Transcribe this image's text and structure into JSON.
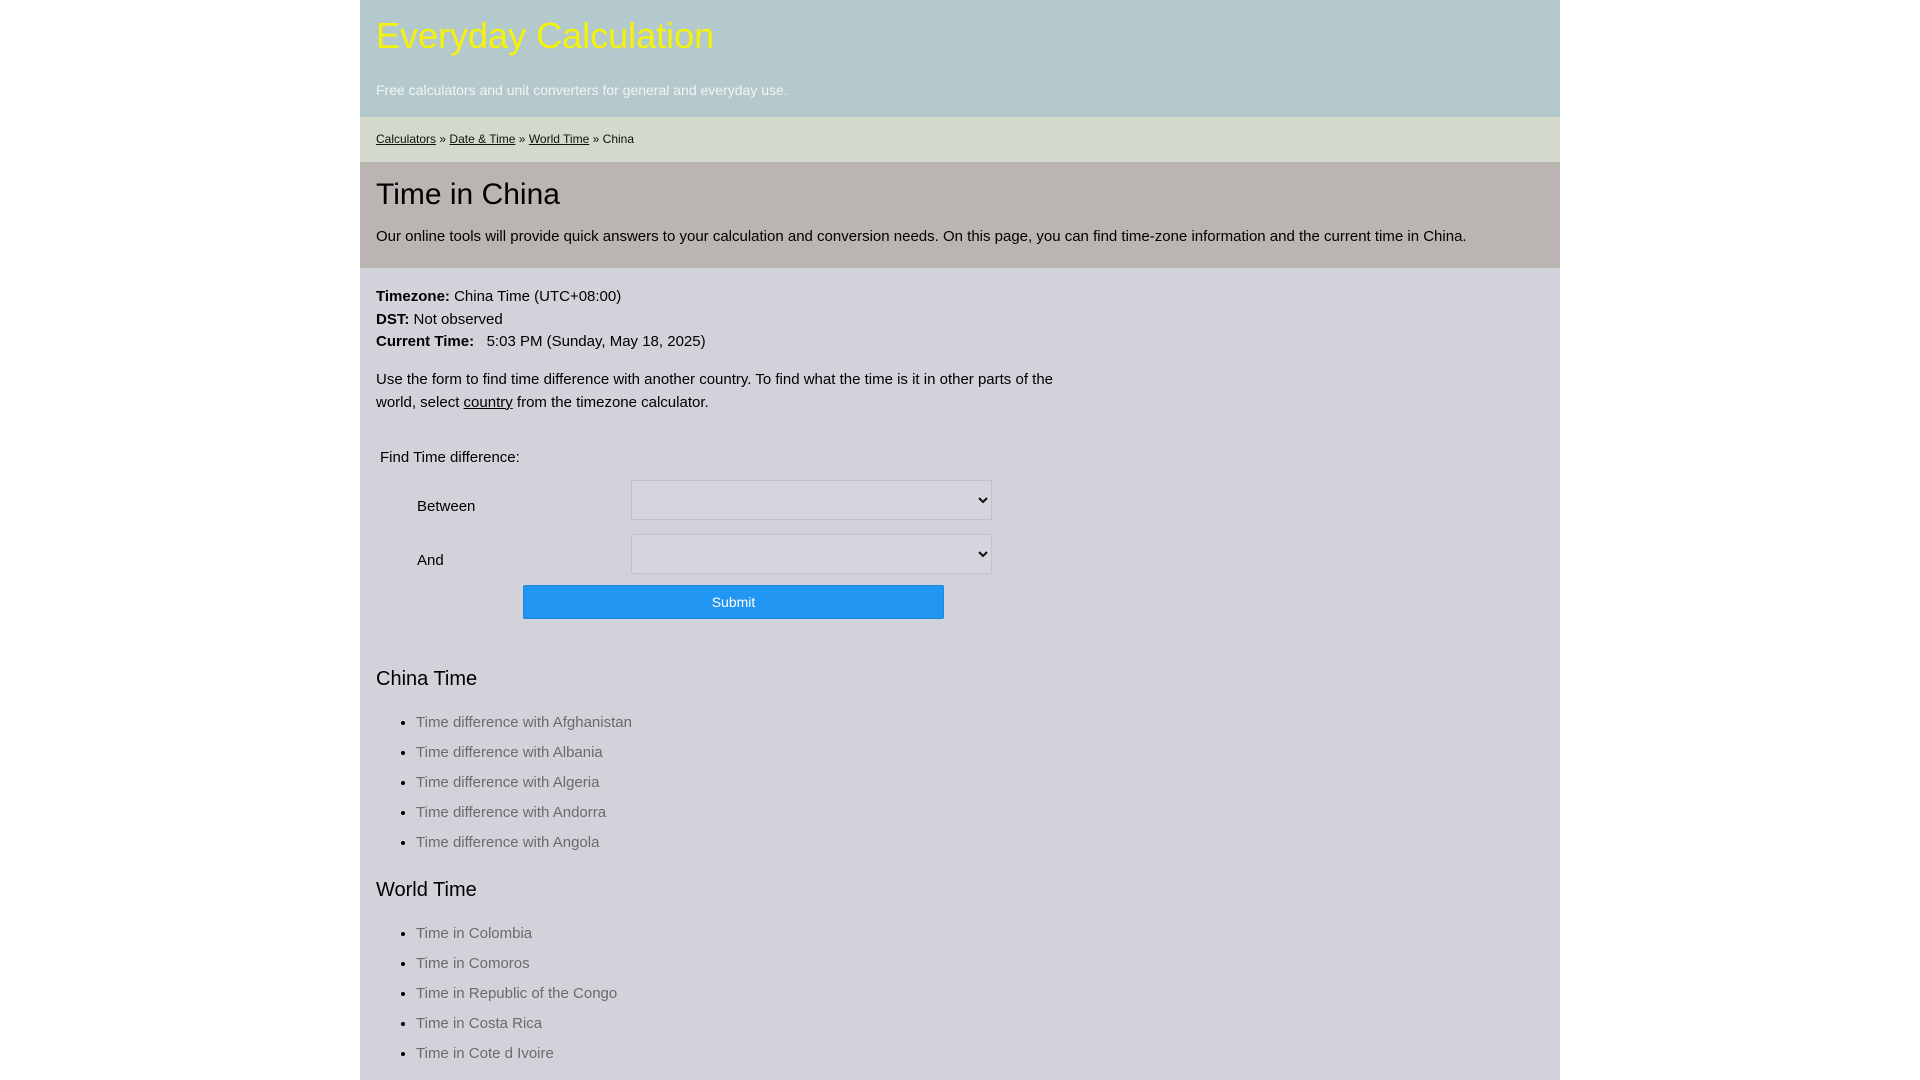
{
  "header": {
    "title": "Everyday Calculation",
    "tagline": "Free calculators and unit converters for general and everyday use."
  },
  "breadcrumb": {
    "items": [
      "Calculators",
      "Date & Time",
      "World Time"
    ],
    "separator": "»",
    "current": "China"
  },
  "intro": {
    "title": "Time in China",
    "text": "Our online tools will provide quick answers to your calculation and conversion needs. On this page, you can find time-zone information and the current time in China."
  },
  "info": {
    "timezone_label": "Timezone:",
    "timezone_value": "China Time (UTC+08:00)",
    "dst_label": "DST:",
    "dst_value": "Not observed",
    "current_label": "Current Time:",
    "current_value": "5:03 PM (Sunday, May 18, 2025)"
  },
  "form_note": {
    "before": "Use the form to find time difference with another country. To find what the time is it in other parts of the world, select ",
    "link": "country",
    "after": " from the timezone calculator."
  },
  "form": {
    "title": "Find Time difference:",
    "between_label": "Between",
    "and_label": "And",
    "between_value": "",
    "and_value": "",
    "submit_label": "Submit"
  },
  "china_time": {
    "title": "China Time",
    "links": [
      "Time difference with Afghanistan",
      "Time difference with Albania",
      "Time difference with Algeria",
      "Time difference with Andorra",
      "Time difference with Angola"
    ]
  },
  "world_time": {
    "title": "World Time",
    "links": [
      "Time in Colombia",
      "Time in Comoros",
      "Time in Republic of the Congo",
      "Time in Costa Rica",
      "Time in Cote d Ivoire"
    ]
  },
  "colors": {
    "header_bg": "#b4c9cb",
    "title_yellow": "#f4f20b",
    "breadcrumb_bg": "#d3d9cb",
    "intro_bg": "#bab5b2",
    "content_bg": "#d2d2da",
    "submit_blue": "#2196f3",
    "link_gray": "#6b6b6b"
  }
}
